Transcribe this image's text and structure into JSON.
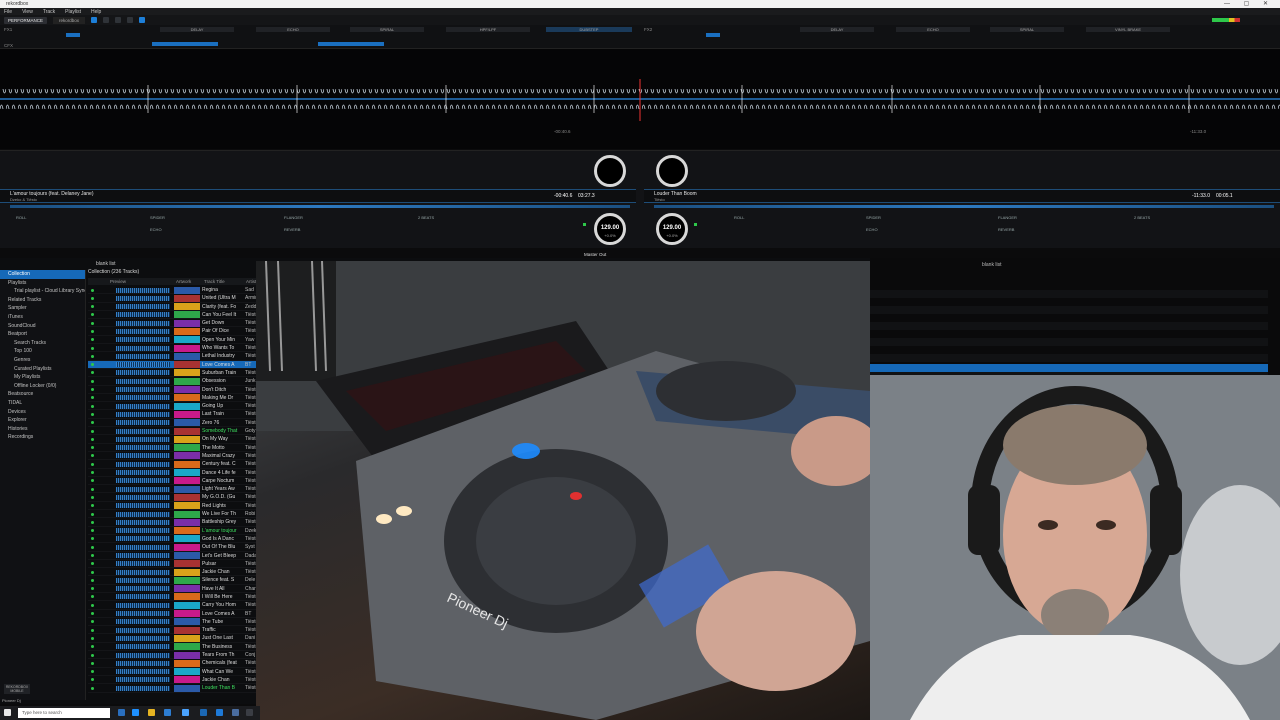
{
  "window": {
    "title": "rekordbox",
    "controls": "— ▢ ✕"
  },
  "menu": [
    "File",
    "View",
    "Track",
    "Playlist",
    "Help"
  ],
  "topbar": {
    "mode": "PERFORMANCE",
    "account": "rekordbox"
  },
  "fx": {
    "left_label": "FX1",
    "right_label": "FX2",
    "left_slots": [
      "DELAY",
      "ECHO",
      "SPIRAL",
      "HPF/LPF",
      "DUBSTEP"
    ],
    "right_slots": [
      "DELAY",
      "ECHO",
      "SPIRAL",
      "VINYL BRAKE"
    ],
    "cfx_label": "CFX"
  },
  "deck1": {
    "title": "L'amour toujours (feat. Delaney Jane)",
    "artist": "Dzeko & Tiësto",
    "bpm": "129.00",
    "bpm_sub": "+0.0%",
    "time": "-00:40.6",
    "time2": "03:27.3",
    "pads": [
      "ROLL",
      "SPIDER",
      "FLANGER",
      "2 BEATS",
      "ECHO",
      "REVERB"
    ]
  },
  "deck2": {
    "title": "Louder Than Boom",
    "artist": "Tiësto",
    "bpm": "129.00",
    "bpm_sub": "+0.0%",
    "time": "-11:33.0",
    "time2": "00:05.1",
    "pads": [
      "ROLL",
      "SPIDER",
      "FLANGER",
      "2 BEATS",
      "ECHO",
      "REVERB"
    ]
  },
  "tree": {
    "items": [
      {
        "label": "Collection",
        "level": 0,
        "sel": true
      },
      {
        "label": "Playlists",
        "level": 0
      },
      {
        "label": "Trial playlist - Cloud Library Sync",
        "level": 1
      },
      {
        "label": "Related Tracks",
        "level": 0
      },
      {
        "label": "Sampler",
        "level": 0
      },
      {
        "label": "iTunes",
        "level": 0
      },
      {
        "label": "SoundCloud",
        "level": 0
      },
      {
        "label": "Beatport",
        "level": 0
      },
      {
        "label": "Search Tracks",
        "level": 1
      },
      {
        "label": "Top 100",
        "level": 1
      },
      {
        "label": "Genres",
        "level": 1
      },
      {
        "label": "Curated Playlists",
        "level": 1
      },
      {
        "label": "My Playlists",
        "level": 1
      },
      {
        "label": "Offline Locker (0/0)",
        "level": 1
      },
      {
        "label": "Beatsource",
        "level": 0
      },
      {
        "label": "TIDAL",
        "level": 0
      },
      {
        "label": "Devices",
        "level": 0
      },
      {
        "label": "Explorer",
        "level": 0
      },
      {
        "label": "Histories",
        "level": 0
      },
      {
        "label": "Recordings",
        "level": 0
      }
    ],
    "footer": "REKORDBOX MOBILE"
  },
  "browser": {
    "tab": "blank list",
    "header": "Collection (236 Tracks)",
    "columns": [
      "Preview",
      "Artwork",
      "Track Title",
      "Artist"
    ],
    "right_tab": "blank list"
  },
  "tracks": [
    {
      "t": "Regina",
      "a": "Sad"
    },
    {
      "t": "United (Ultra M",
      "a": "Armin"
    },
    {
      "t": "Clarity (feat. Fo",
      "a": "Zedd"
    },
    {
      "t": "Can You Feel It",
      "a": "Tiësto"
    },
    {
      "t": "Get Down",
      "a": "Tiësto"
    },
    {
      "t": "Pair Of Dice",
      "a": "Tiësto"
    },
    {
      "t": "Open Your Min",
      "a": "Yaw"
    },
    {
      "t": "Who Wants To",
      "a": "Tiësto"
    },
    {
      "t": "Lethal Industry",
      "a": "Tiësto"
    },
    {
      "t": "Love Comes A",
      "a": "BT",
      "sel": true
    },
    {
      "t": "Suburban Train",
      "a": "Tiësto"
    },
    {
      "t": "Obsession",
      "a": "Junk"
    },
    {
      "t": "Don't Ditch",
      "a": "Tiësto"
    },
    {
      "t": "Making Me Dr",
      "a": "Tiësto"
    },
    {
      "t": "Going Up",
      "a": "Tiësto"
    },
    {
      "t": "Last Train",
      "a": "Tiësto"
    },
    {
      "t": "Zero 76",
      "a": "Tiësto"
    },
    {
      "t": "Somebody That",
      "a": "Goty",
      "g": true
    },
    {
      "t": "On My Way",
      "a": "Tiësto"
    },
    {
      "t": "The Motto",
      "a": "Tiësto"
    },
    {
      "t": "Maximal Crazy",
      "a": "Tiësto"
    },
    {
      "t": "Century feat. C",
      "a": "Tiësto"
    },
    {
      "t": "Dance 4 Life fe",
      "a": "Tiësto"
    },
    {
      "t": "Carpe Noctum",
      "a": "Tiësto"
    },
    {
      "t": "Light Years Aw",
      "a": "Tiësto"
    },
    {
      "t": "My G.O.D. (Gu",
      "a": "Tiësto"
    },
    {
      "t": "Red Lights",
      "a": "Tiësto"
    },
    {
      "t": "We Live For Th",
      "a": "Robi"
    },
    {
      "t": "Battleship Grey",
      "a": "Tiësto"
    },
    {
      "t": "L'amour toujour",
      "a": "Dzek",
      "g": true
    },
    {
      "t": "God Is A Danc",
      "a": "Tiësto"
    },
    {
      "t": "Out Of The Blu",
      "a": "Syst"
    },
    {
      "t": "Let's Get Bleep",
      "a": "Dada"
    },
    {
      "t": "Pulsar",
      "a": "Tiësto"
    },
    {
      "t": "Jackie Chan",
      "a": "Tiësto"
    },
    {
      "t": "Silence feat. S",
      "a": "Dele"
    },
    {
      "t": "Have It All",
      "a": "Char"
    },
    {
      "t": "I Will Be Here",
      "a": "Tiësto"
    },
    {
      "t": "Carry You Hom",
      "a": "Tiësto"
    },
    {
      "t": "Love Comes A",
      "a": "BT"
    },
    {
      "t": "The Tube",
      "a": "Tiësto"
    },
    {
      "t": "Traffic",
      "a": "Tiësto"
    },
    {
      "t": "Just One Last",
      "a": "Dani"
    },
    {
      "t": "The Business",
      "a": "Tiësto"
    },
    {
      "t": "Tears From Th",
      "a": "Conj"
    },
    {
      "t": "Chemicals (feat",
      "a": "Tiësto"
    },
    {
      "t": "What Can We",
      "a": "Tiësto"
    },
    {
      "t": "Jackie Chan",
      "a": "Tiësto"
    },
    {
      "t": "Louder Than B",
      "a": "Tiësto",
      "g": true
    }
  ],
  "master": {
    "label": "Master Out"
  },
  "taskbar": {
    "search": "Type here to search"
  },
  "brand": "Pioneer Dj",
  "colors": {
    "accent": "#1669b8",
    "green": "#2ec84a",
    "wave": "#3a8ad8"
  }
}
